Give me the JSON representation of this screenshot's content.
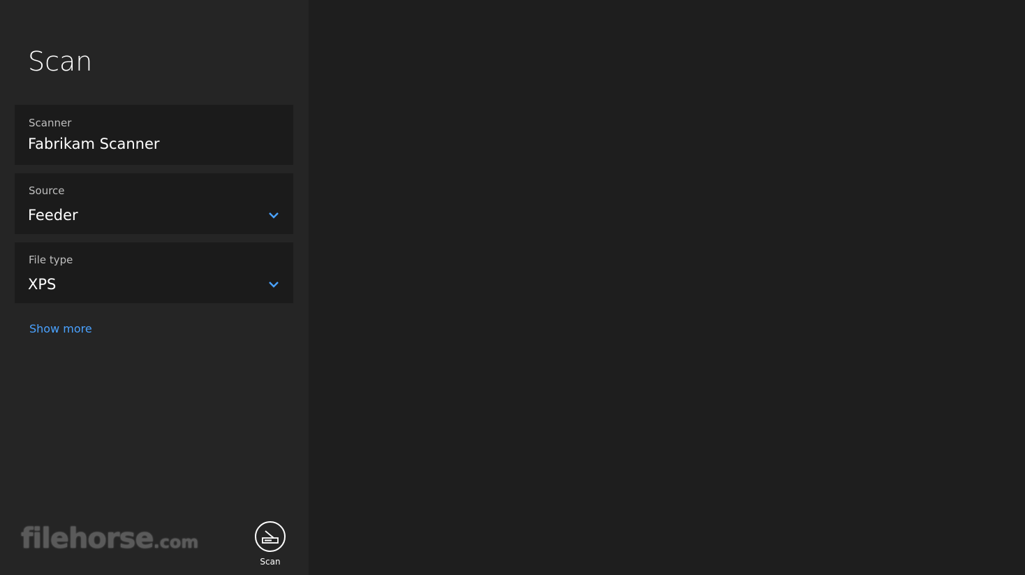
{
  "panel": {
    "title": "Scan",
    "scanner": {
      "label": "Scanner",
      "value": "Fabrikam Scanner"
    },
    "source": {
      "label": "Source",
      "value": "Feeder"
    },
    "file_type": {
      "label": "File type",
      "value": "XPS"
    },
    "show_more_label": "Show more"
  },
  "app_bar": {
    "scan_label": "Scan",
    "scan_icon": "scanner-icon"
  },
  "watermark": {
    "main": "filehorse",
    "tld": ".com"
  },
  "colors": {
    "accent": "#4aa2ff",
    "panel_bg": "#252525",
    "main_bg": "#1e1e1e",
    "field_bg": "#1b1b1b"
  }
}
